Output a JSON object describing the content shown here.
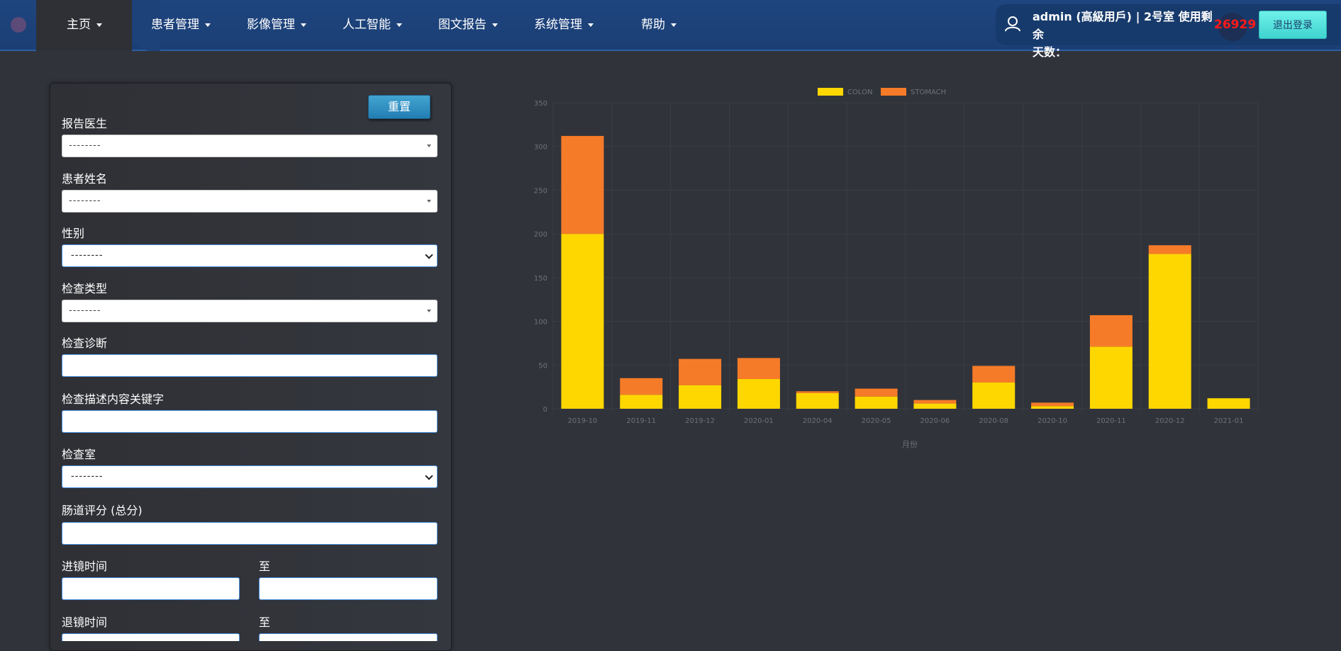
{
  "nav": {
    "items": [
      {
        "label": "主页"
      },
      {
        "label": "患者管理"
      },
      {
        "label": "影像管理"
      },
      {
        "label": "人工智能"
      },
      {
        "label": "图文报告"
      },
      {
        "label": "系统管理"
      },
      {
        "label": "帮助"
      }
    ],
    "user_line1": "admin (高級用戶) | 2号室 使用剩余",
    "user_line2": "天数：",
    "days_remaining": "26929",
    "logout_label": "退出登录",
    "icons": {
      "user": "user-icon",
      "caret": "caret-down-icon"
    }
  },
  "filters": {
    "reset_label": "重置",
    "doctor": {
      "label": "报告医生",
      "value": "--------"
    },
    "patient_name": {
      "label": "患者姓名",
      "value": "--------"
    },
    "gender": {
      "label": "性别",
      "value": "--------"
    },
    "exam_type": {
      "label": "检查类型",
      "value": "--------"
    },
    "diagnosis": {
      "label": "检查诊断",
      "value": ""
    },
    "keyword": {
      "label": "检查描述内容关键字",
      "value": ""
    },
    "room": {
      "label": "检查室",
      "value": "--------"
    },
    "bowel_score": {
      "label": "肠道评分 (总分)",
      "value": ""
    },
    "insert_time": {
      "label": "进镜时间",
      "to_label": "至",
      "from_value": "",
      "to_value": ""
    },
    "withdraw_time": {
      "label": "退镜时间",
      "to_label": "至"
    }
  },
  "chart_data": {
    "type": "bar",
    "stacked": true,
    "categories": [
      "2019-10",
      "2019-11",
      "2019-12",
      "2020-01",
      "2020-04",
      "2020-05",
      "2020-06",
      "2020-08",
      "2020-10",
      "2020-11",
      "2020-12",
      "2021-01"
    ],
    "series": [
      {
        "name": "COLON",
        "color": "#ffd700",
        "values": [
          200,
          16,
          27,
          34,
          18,
          14,
          6,
          30,
          3,
          71,
          177,
          12
        ]
      },
      {
        "name": "STOMACH",
        "color": "#f67b28",
        "values": [
          112,
          19,
          30,
          24,
          2,
          9,
          4,
          19,
          4,
          36,
          10,
          0
        ]
      }
    ],
    "xlabel": "月份",
    "ylabel": "",
    "ylim": [
      0,
      350
    ],
    "yticks": [
      0,
      50,
      100,
      150,
      200,
      250,
      300,
      350
    ],
    "grid": true,
    "legend": "top-center"
  }
}
